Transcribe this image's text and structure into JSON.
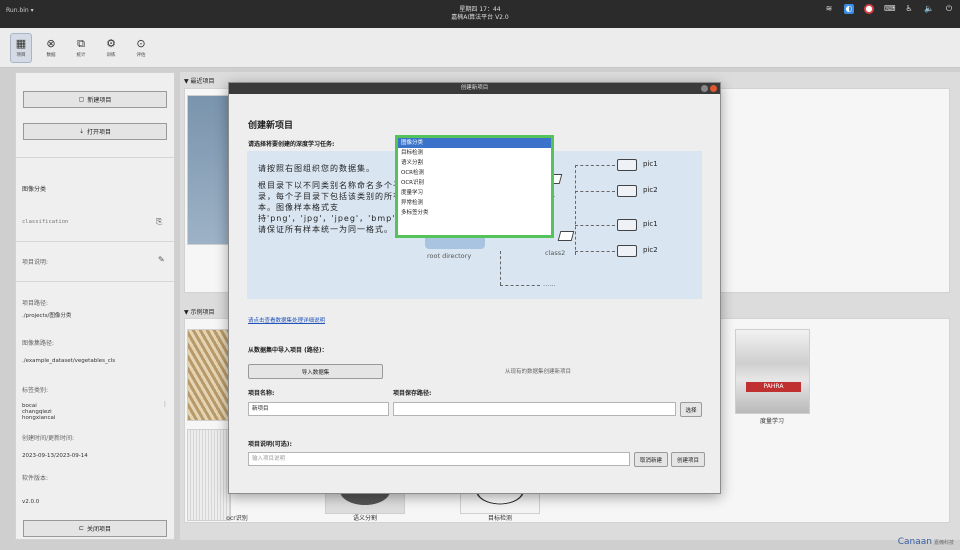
{
  "system_bar": {
    "app_name": "Run.bin ▾",
    "clock": "星期四 17：44",
    "app_title": "嘉楠AI算法平台 V2.0"
  },
  "toolbar": {
    "tools": [
      {
        "label": "项目",
        "icon": "project-icon",
        "glyph": "▦"
      },
      {
        "label": "数据",
        "icon": "data-icon",
        "glyph": "⊗"
      },
      {
        "label": "统计",
        "icon": "stats-icon",
        "glyph": "⧉"
      },
      {
        "label": "训练",
        "icon": "train-icon",
        "glyph": "⚙"
      },
      {
        "label": "评估",
        "icon": "evaluate-icon",
        "glyph": "⊙"
      }
    ]
  },
  "sidebar": {
    "new_project": "新建项目",
    "open_project": "打开项目",
    "task_type": "图像分类",
    "project_name": "classification",
    "description_label": "项目说明:",
    "path_label": "项目路径:",
    "path_value": "./projects/图像分类",
    "dataset_path_label": "图像集路径:",
    "dataset_path_value": "./example_dataset/vegetables_cls",
    "classes_label": "标签类别:",
    "classes": [
      "bocai",
      "changqiezi",
      "hongxiancai"
    ],
    "dates_label": "创建时间/更新时间:",
    "dates_value": "2023-09-13/2023-09-14",
    "version_label": "软件版本:",
    "version_value": "v2.0.0",
    "close_project": "关闭项目"
  },
  "main": {
    "recent_title": "最近项目",
    "examples_title": "示例项目",
    "examples": [
      {
        "caption": "ocr识别"
      },
      {
        "caption": "语义分割"
      },
      {
        "caption": "目标检测"
      },
      {
        "caption": "度量学习"
      }
    ]
  },
  "dialog": {
    "title": "创建新项目",
    "heading": "创建新项目",
    "task_prompt": "请选择将要创建的深度学习任务:",
    "diagram": {
      "text_1": "请按照右图组织您的数据集。",
      "text_2": "根目录下以不同类别名称命名多个子目录，每个子目录下包括该类别的所有样本。图像样本格式支持'png'，'jpg'，'jpeg'，'bmp'，'tif'，'tiff'，'webp'，请保证所有样本统一为同一格式。",
      "root_label": "root directory",
      "class1_label": "s1",
      "class2_label": "class2",
      "pic1": "pic1",
      "pic2": "pic2",
      "ellipsis": "......"
    },
    "task_options": [
      "图像分类",
      "目标检测",
      "语义分割",
      "OCR检测",
      "OCR识别",
      "度量学习",
      "异常检测",
      "多标签分类"
    ],
    "selected_task": "图像分类",
    "detail_link": "请点击查看数据集处理详细说明",
    "import_label": "从数据集中导入项目 (路径)：",
    "import_button": "导入数据集",
    "import_hint": "从现有的数据集创建新项目",
    "name_label": "项目名称:",
    "name_value": "新项目",
    "save_path_label": "项目保存路径:",
    "save_path_value": "",
    "choose_button": "选择",
    "desc_label": "项目说明(可选):",
    "desc_placeholder": "输入项目说明",
    "cancel_button": "取消新建",
    "create_button": "创建项目"
  },
  "brand": {
    "logo": "Canaan",
    "name": "嘉楠科技"
  },
  "colors": {
    "selection": "#3a73c9",
    "dropdown_highlight": "#55c35a",
    "diagram_bg": "#d9e6f2"
  }
}
